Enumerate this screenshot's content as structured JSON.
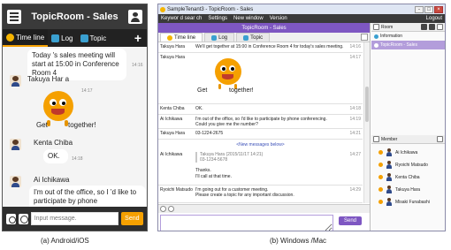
{
  "phone": {
    "title": "TopicRoom - Sales",
    "tabs": [
      {
        "label": "Time line",
        "icon": "clock-icon",
        "active": true
      },
      {
        "label": "Log",
        "icon": "log-icon",
        "active": false
      },
      {
        "label": "Topic",
        "icon": "topic-icon",
        "active": false
      }
    ],
    "add_label": "+",
    "messages": {
      "first_text": "Today 's sales meeting will start at 15:00 in Conference Room 4",
      "first_time": "14:16",
      "takuya_name": "Takuya Har a",
      "takuya_time": "14:17",
      "sticker_left": "Get",
      "sticker_right": "together!",
      "kenta_name": "Kenta Chiba",
      "kenta_time": "14:18",
      "kenta_text": "OK.",
      "ai_name": "Ai Ichikawa",
      "ai_text": "I'm out of the office, so I ’d like to participate by phone conferencing. Could you give me the number?",
      "ai_time": "14:19"
    },
    "input_placeholder": "Input message.",
    "send_label": "Send",
    "caption": "(a) Android/iOS"
  },
  "desktop": {
    "window_title": "SampleTenant3 - TopicRoom - Sales",
    "menu": [
      "Keywor d sear ch",
      "Settings",
      "New window",
      "Version"
    ],
    "logout_label": "Logout",
    "room_header": "TopicRoom - Sales",
    "tabs": [
      {
        "label": "Time line",
        "active": true
      },
      {
        "label": "Log",
        "active": false
      },
      {
        "label": "Topic",
        "active": false
      }
    ],
    "rows": [
      {
        "name": "Takuya Hara",
        "text": "We'll get together at 15:00 in Conference Room 4 for today's sales meeting.",
        "time": "14:16"
      },
      {
        "name": "Takuya Hara",
        "text": "",
        "time": "14:17"
      },
      {
        "name": "Kenta Chiba",
        "text": "OK.",
        "time": "14:18"
      },
      {
        "name": "Ai Ichikawa",
        "text": "I'm out of the office, so I'd like to participate by phone conferencing.",
        "text2": "Could you give me the number?",
        "time": "14:19"
      },
      {
        "name": "Takuya Hara",
        "text": "03-1224-2675",
        "time": "14:21"
      }
    ],
    "sticker_left": "Get",
    "sticker_right": "together!",
    "new_messages_label": "<New messages below>",
    "quoted": {
      "name": "Ai Ichikawa",
      "quote_head": "Takuya Hara (2015/11/17 14:21)",
      "quote_body": "03-1234-5678",
      "reply1": "Thanks.",
      "reply2": "I'll call at that time.",
      "time": "14:27"
    },
    "last": {
      "name": "Ryoichi Matsudo",
      "text1": "I'm going out for a customer meeting.",
      "text2": "Please create a topic for any important discussion.",
      "time": "14:29"
    },
    "send_label": "Send",
    "side": {
      "room_label": "Room",
      "room_items": [
        "Information",
        "TopicRoom - Sales"
      ],
      "member_label": "Member",
      "members": [
        "Ai Ichikawa",
        "Ryoichi Matsudo",
        "Kenta Chiba",
        "Takuya Hara",
        "Misaki Funabashi"
      ]
    },
    "caption": "(b) Windows /Mac"
  },
  "colors": {
    "phone_accent": "#f5a000",
    "desktop_accent": "#7e57c2"
  }
}
